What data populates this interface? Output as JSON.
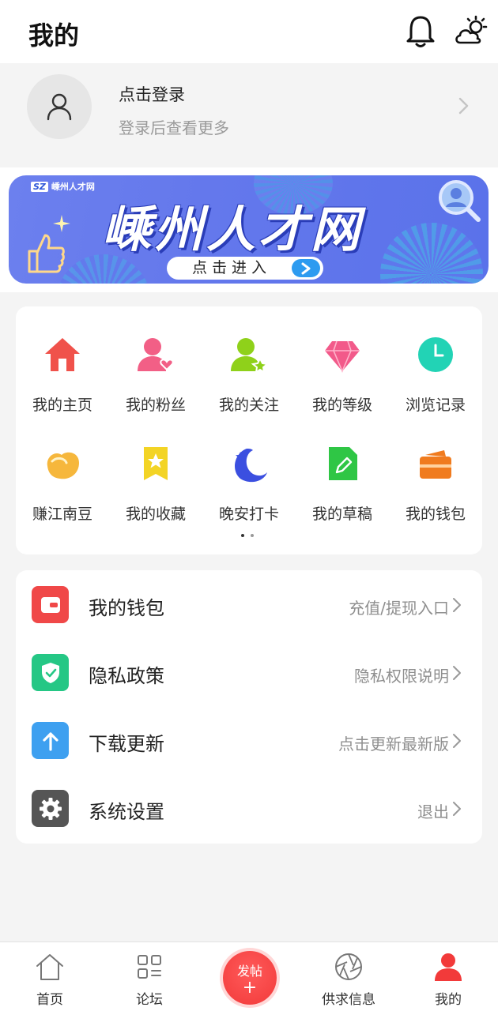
{
  "header": {
    "title": "我的",
    "icons": [
      "bell-icon",
      "weather-icon"
    ]
  },
  "login": {
    "main": "点击登录",
    "sub": "登录后查看更多"
  },
  "banner": {
    "logo_badge": "SZ",
    "logo_text": "嵊州人才网",
    "headline": "嵊州人才网",
    "enter": "点击进入"
  },
  "grid": {
    "items": [
      {
        "label": "我的主页",
        "icon": "home-icon"
      },
      {
        "label": "我的粉丝",
        "icon": "fans-icon"
      },
      {
        "label": "我的关注",
        "icon": "follow-icon"
      },
      {
        "label": "我的等级",
        "icon": "diamond-icon"
      },
      {
        "label": "浏览记录",
        "icon": "clock-icon"
      },
      {
        "label": "赚江南豆",
        "icon": "bean-icon"
      },
      {
        "label": "我的收藏",
        "icon": "bookmark-icon"
      },
      {
        "label": "晚安打卡",
        "icon": "moon-icon"
      },
      {
        "label": "我的草稿",
        "icon": "draft-icon"
      },
      {
        "label": "我的钱包",
        "icon": "wallet-icon"
      }
    ],
    "page_dots": 2
  },
  "list": {
    "rows": [
      {
        "title": "我的钱包",
        "right": "充值/提现入口",
        "icon": "wallet-icon",
        "color": "#f04848"
      },
      {
        "title": "隐私政策",
        "right": "隐私权限说明",
        "icon": "shield-icon",
        "color": "#25c785"
      },
      {
        "title": "下载更新",
        "right": "点击更新最新版",
        "icon": "upload-arrow-icon",
        "color": "#3ea0f0"
      },
      {
        "title": "系统设置",
        "right": "退出",
        "icon": "gear-icon",
        "color": "#555555"
      }
    ]
  },
  "tabbar": {
    "items": [
      {
        "label": "首页",
        "icon": "home-outline-icon",
        "active": false
      },
      {
        "label": "论坛",
        "icon": "grid-icon",
        "active": false
      },
      {
        "label": "供求信息",
        "icon": "aperture-icon",
        "active": false
      },
      {
        "label": "我的",
        "icon": "person-icon",
        "active": true
      }
    ],
    "post": {
      "label": "发帖",
      "plus": "+"
    }
  },
  "colors": {
    "accent": "#f23a3a",
    "banner": "#6478ec"
  }
}
